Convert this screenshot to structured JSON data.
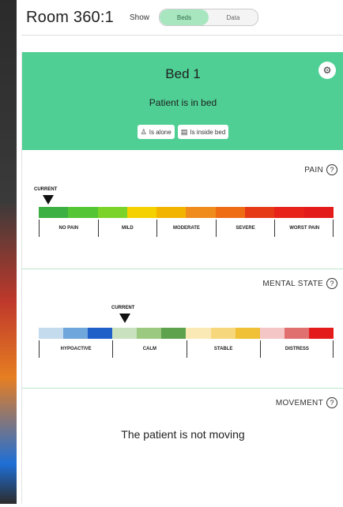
{
  "header": {
    "room_title": "Room 360:1",
    "show_label": "Show",
    "toggle": {
      "beds_label": "Beds",
      "data_label": "Data",
      "selected": "Beds"
    }
  },
  "bed": {
    "title": "Bed 1",
    "status": "Patient is in bed",
    "settings_icon": "gear-icon",
    "chips": [
      {
        "icon": "person-icon",
        "label": "Is alone"
      },
      {
        "icon": "bed-icon",
        "label": "Is inside bed"
      }
    ],
    "accent_color": "#4fcf94"
  },
  "pain": {
    "title": "PAIN",
    "current_label": "CURRENT",
    "current_level": "NO PAIN",
    "levels": [
      "NO PAIN",
      "MILD",
      "MODERATE",
      "SEVERE",
      "WORST PAIN"
    ],
    "colors": [
      "#3cb043",
      "#54c534",
      "#7bd32a",
      "#f5d100",
      "#f3b400",
      "#f08c1c",
      "#ef6c15",
      "#e63a16",
      "#e8231a",
      "#e41b1b"
    ]
  },
  "mental": {
    "title": "MENTAL STATE",
    "current_label": "CURRENT",
    "current_level": "CALM",
    "levels": [
      "HYPOACTIVE",
      "CALM",
      "STABLE",
      "DISTRESS"
    ],
    "colors": [
      "#c4dbee",
      "#6fa6dc",
      "#1f5fc8",
      "#c9e1bf",
      "#9bc97f",
      "#5ea24d",
      "#fbe9b5",
      "#f6d77b",
      "#f0c036",
      "#f4c6c6",
      "#e07070",
      "#e41b1b"
    ]
  },
  "movement": {
    "title": "MOVEMENT",
    "message": "The patient is not moving"
  }
}
